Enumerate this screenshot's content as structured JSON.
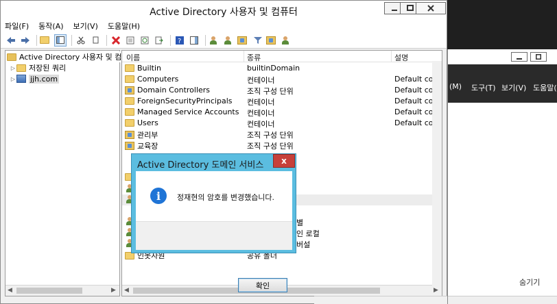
{
  "main_window": {
    "title": "Active Directory 사용자 및 컴퓨터",
    "menu": [
      "파일(F)",
      "동작(A)",
      "보기(V)",
      "도움말(H)"
    ]
  },
  "tree": {
    "root": "Active Directory 사용자 및 컴퓨",
    "saved_queries": "저장된 쿼리",
    "domain": "jjh.com"
  },
  "list": {
    "columns": [
      "이름",
      "종류",
      "설명"
    ],
    "rows": [
      {
        "name": "Builtin",
        "type": "builtinDomain",
        "desc": "",
        "icon": "folder"
      },
      {
        "name": "Computers",
        "type": "컨테이너",
        "desc": "Default contain",
        "icon": "folder"
      },
      {
        "name": "Domain Controllers",
        "type": "조직 구성 단위",
        "desc": "Default contain",
        "icon": "ou"
      },
      {
        "name": "ForeignSecurityPrincipals",
        "type": "컨테이너",
        "desc": "Default contain",
        "icon": "folder"
      },
      {
        "name": "Managed Service Accounts",
        "type": "컨테이너",
        "desc": "Default contain",
        "icon": "folder"
      },
      {
        "name": "Users",
        "type": "컨테이너",
        "desc": "Default contain",
        "icon": "folder"
      },
      {
        "name": "관리부",
        "type": "조직 구성 단위",
        "desc": "",
        "icon": "ou"
      },
      {
        "name": "교육장",
        "type": "조직 구성 단위",
        "desc": "",
        "icon": "ou"
      }
    ],
    "partial_type_1": "별",
    "partial_type_2": "인 로컬",
    "partial_type_3": "버설",
    "last_row_name": "인못자원",
    "last_row_type": "공유 폴더"
  },
  "background_window": {
    "menu": [
      "(M)",
      "도구(T)",
      "보기(V)",
      "도움말("
    ],
    "hide_label": "숨기기"
  },
  "dialog": {
    "title": "Active Directory 도메인 서비스",
    "message": "정재현의 암호를 변경했습니다.",
    "ok_label": "확인",
    "close_glyph": "x",
    "info_glyph": "i"
  },
  "colors": {
    "dialog_frame": "#5bbde0",
    "dialog_close": "#c7403a",
    "info_icon": "#1f74d6"
  }
}
